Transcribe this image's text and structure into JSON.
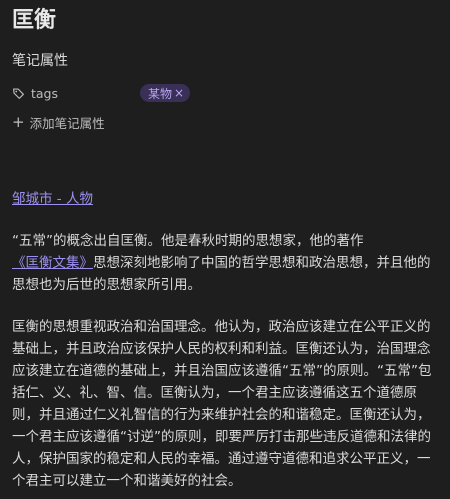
{
  "note": {
    "title": "匡衡"
  },
  "properties": {
    "heading": "笔记属性",
    "tags_label": "tags",
    "tag_value": "某物",
    "tag_remove": "×",
    "add_label": "添加笔记属性"
  },
  "content": {
    "link_text": "邹城市 - 人物",
    "para1_before": "“五常”的概念出自匡衡。他是春秋时期的思想家，他的著作",
    "para1_link": "《匡衡文集》",
    "para1_after": "思想深刻地影响了中国的哲学思想和政治思想，并且他的思想也为后世的思想家所引用。",
    "para2": "匡衡的思想重视政治和治国理念。他认为，政治应该建立在公平正义的基础上，并且政治应该保护人民的权利和利益。匡衡还认为，治国理念应该建立在道德的基础上，并且治国应该遵循“五常”的原则。“五常”包括仁、义、礼、智、信。匡衡认为，一个君主应该遵循这五个道德原则，并且通过仁义礼智信的行为来维护社会的和谐稳定。匡衡还认为，一个君主应该遵循“讨逆”的原则，即要严厉打击那些违反道德和法律的人，保护国家的稳定和人民的幸福。通过遵守道德和追求公平正义，一个君主可以建立一个和谐美好的社会。"
  },
  "colors": {
    "background": "#1e1e1e",
    "text": "#dadada",
    "accent_link": "#9d8ff0",
    "tag_bg": "#3a2f57",
    "tag_text": "#b9a7f0"
  },
  "icons": {
    "tag": "tag-icon",
    "add": "plus-icon"
  }
}
